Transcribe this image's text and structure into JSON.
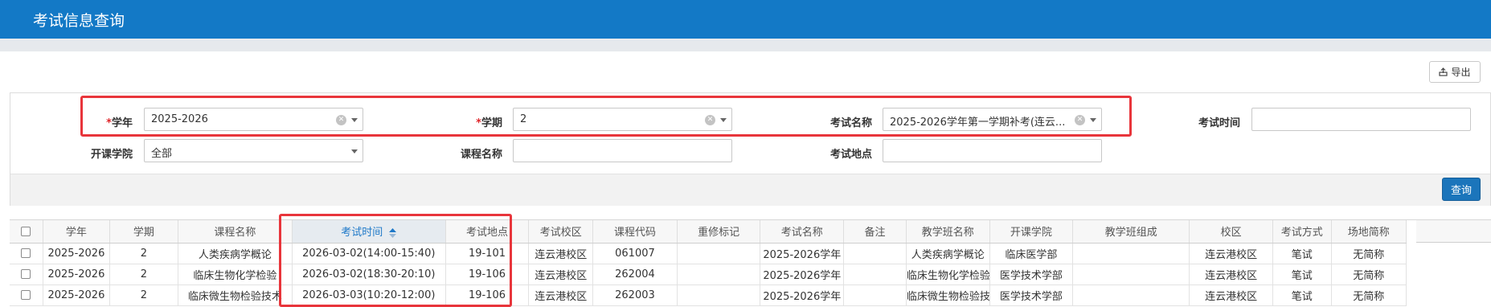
{
  "header": {
    "title": "考试信息查询"
  },
  "toolbar": {
    "export_label": "导出"
  },
  "filters": {
    "required_mark": "*",
    "year": {
      "label": "学年",
      "value": "2025-2026"
    },
    "term": {
      "label": "学期",
      "value": "2"
    },
    "exam_name": {
      "label": "考试名称",
      "value": "2025-2026学年第一学期补考(连云..."
    },
    "exam_time": {
      "label": "考试时间",
      "value": ""
    },
    "college": {
      "label": "开课学院",
      "value": "全部"
    },
    "course_name": {
      "label": "课程名称",
      "value": ""
    },
    "exam_location": {
      "label": "考试地点",
      "value": ""
    },
    "query_label": "查询"
  },
  "grid": {
    "columns": [
      "学年",
      "学期",
      "课程名称",
      "考试时间",
      "考试地点",
      "考试校区",
      "课程代码",
      "重修标记",
      "考试名称",
      "备注",
      "教学班名称",
      "开课学院",
      "教学班组成",
      "校区",
      "考试方式",
      "场地简称"
    ],
    "sorted_column": "考试时间",
    "rows": [
      [
        "2025-2026",
        "2",
        "人类疾病学概论",
        "2026-03-02(14:00-15:40)",
        "19-101",
        "连云港校区",
        "061007",
        "",
        "2025-2026学年",
        "",
        "人类疾病学概论",
        "临床医学部",
        "",
        "连云港校区",
        "笔试",
        "无简称"
      ],
      [
        "2025-2026",
        "2",
        "临床生物化学检验",
        "2026-03-02(18:30-20:10)",
        "19-106",
        "连云港校区",
        "262004",
        "",
        "2025-2026学年",
        "",
        "临床生物化学检验",
        "医学技术学部",
        "",
        "连云港校区",
        "笔试",
        "无简称"
      ],
      [
        "2025-2026",
        "2",
        "临床微生物检验技术",
        "2026-03-03(10:20-12:00)",
        "19-106",
        "连云港校区",
        "262003",
        "",
        "2025-2026学年",
        "",
        "临床微生物检验技术",
        "医学技术学部",
        "",
        "连云港校区",
        "笔试",
        "无简称"
      ]
    ]
  },
  "colors": {
    "accent": "#1379c6",
    "highlight": "#e8353b",
    "button": "#1b75bb"
  }
}
